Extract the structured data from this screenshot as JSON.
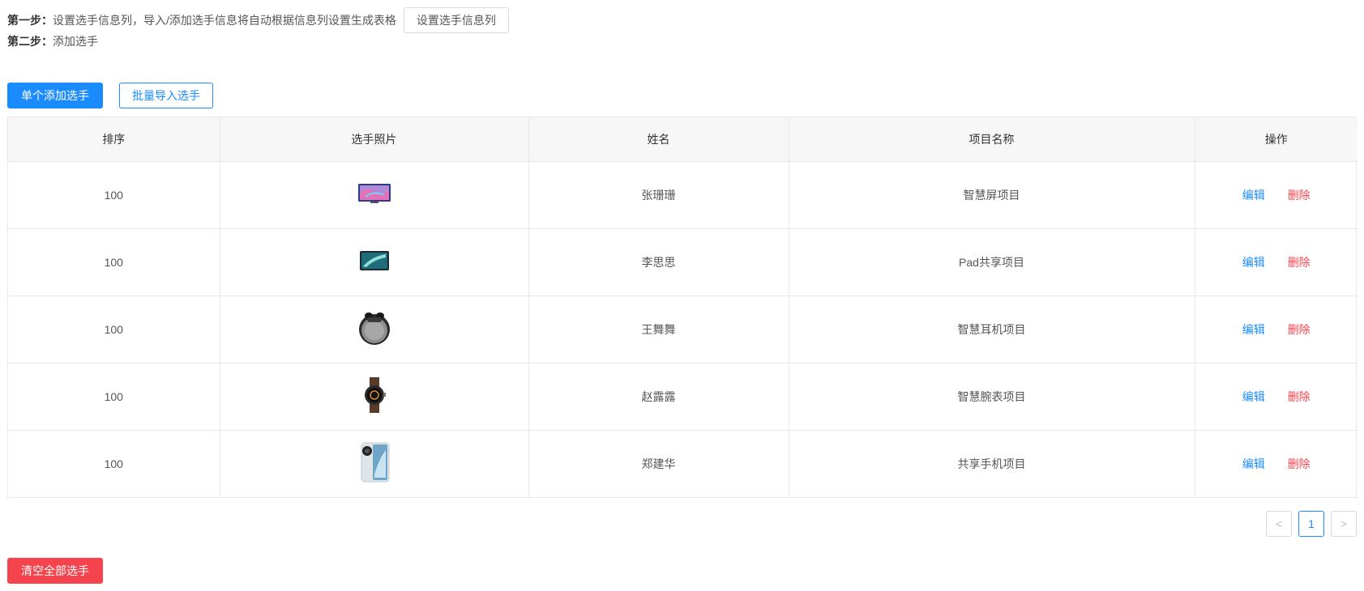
{
  "steps": {
    "step1_label": "第一步：",
    "step1_text": "设置选手信息列，导入/添加选手信息将自动根据信息列设置生成表格",
    "set_columns_button": "设置选手信息列",
    "step2_label": "第二步：",
    "step2_text": "添加选手"
  },
  "actions": {
    "add_single": "单个添加选手",
    "batch_import": "批量导入选手",
    "clear_all": "清空全部选手"
  },
  "table": {
    "headers": [
      "排序",
      "选手照片",
      "姓名",
      "项目名称",
      "操作"
    ],
    "edit_label": "编辑",
    "delete_label": "删除",
    "rows": [
      {
        "order": "100",
        "photo_icon": "tv-icon",
        "name": "张珊珊",
        "project": "智慧屏项目"
      },
      {
        "order": "100",
        "photo_icon": "tablet-icon",
        "name": "李思思",
        "project": "Pad共享项目"
      },
      {
        "order": "100",
        "photo_icon": "earbuds-icon",
        "name": "王舞舞",
        "project": "智慧耳机项目"
      },
      {
        "order": "100",
        "photo_icon": "watch-icon",
        "name": "赵露露",
        "project": "智慧腕表项目"
      },
      {
        "order": "100",
        "photo_icon": "phone-icon",
        "name": "郑建华",
        "project": "共享手机项目"
      }
    ]
  },
  "pagination": {
    "prev": "<",
    "current": "1",
    "next": ">"
  },
  "colors": {
    "primary": "#1a8cff",
    "danger": "#f5444d",
    "header_bg": "#f7f7f7",
    "border": "#e8e8e8"
  }
}
